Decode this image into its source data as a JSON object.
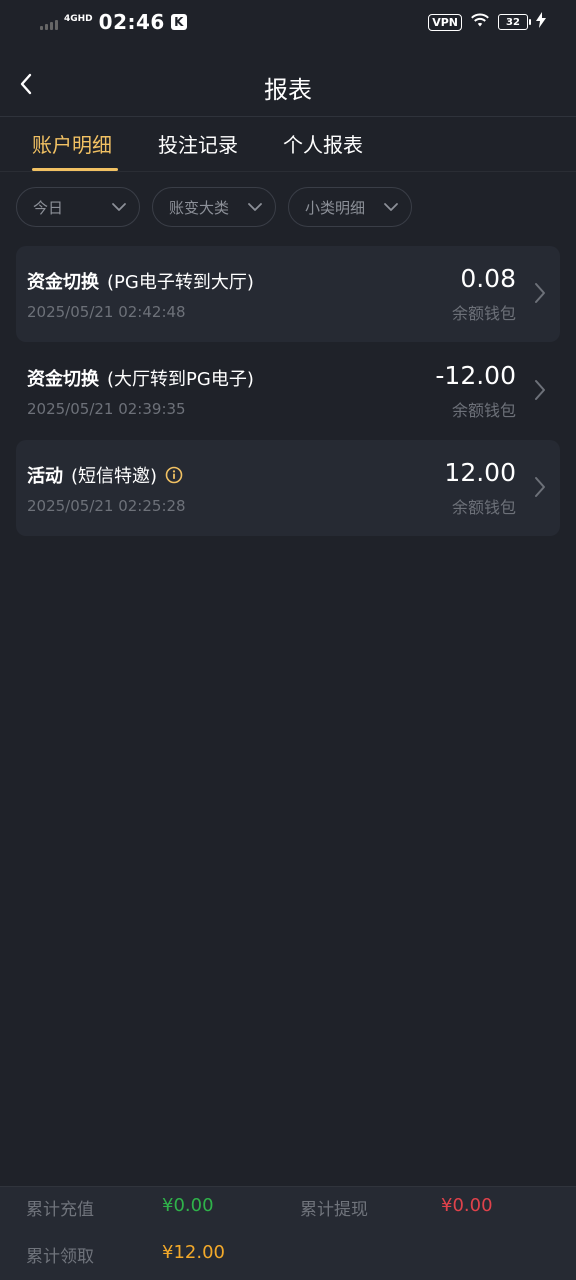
{
  "status_bar": {
    "network": "4GHD",
    "time": "02:46",
    "app_badge": "K",
    "vpn": "VPN",
    "battery": "32"
  },
  "header": {
    "title": "报表"
  },
  "tabs": [
    {
      "label": "账户明细",
      "active": true
    },
    {
      "label": "投注记录",
      "active": false
    },
    {
      "label": "个人报表",
      "active": false
    }
  ],
  "filters": [
    {
      "label": "今日"
    },
    {
      "label": "账变大类"
    },
    {
      "label": "小类明细"
    }
  ],
  "records": [
    {
      "type": "资金切换",
      "detail": "(PG电子转到大厅)",
      "time": "2025/05/21 02:42:48",
      "amount": "0.08",
      "wallet": "余额钱包",
      "has_info": false
    },
    {
      "type": "资金切换",
      "detail": "(大厅转到PG电子)",
      "time": "2025/05/21 02:39:35",
      "amount": "-12.00",
      "wallet": "余额钱包",
      "has_info": false
    },
    {
      "type": "活动",
      "detail": "(短信特邀)",
      "time": "2025/05/21 02:25:28",
      "amount": "12.00",
      "wallet": "余额钱包",
      "has_info": true
    }
  ],
  "footer": {
    "recharge_label": "累计充值",
    "recharge_value": "¥0.00",
    "withdraw_label": "累计提现",
    "withdraw_value": "¥0.00",
    "claim_label": "累计领取",
    "claim_value": "¥12.00"
  },
  "colors": {
    "background": "#1f2229",
    "card": "#262a33",
    "accent": "#f1c163",
    "green": "#2fb34a",
    "red": "#e0424b",
    "orange": "#f3a92a",
    "muted": "#6d7179"
  },
  "icons": {
    "back": "chevron-left-icon",
    "dropdown": "chevron-down-icon",
    "row_arrow": "chevron-right-icon",
    "info": "info-circle-icon",
    "wifi": "wifi-icon",
    "charging": "bolt-icon"
  }
}
